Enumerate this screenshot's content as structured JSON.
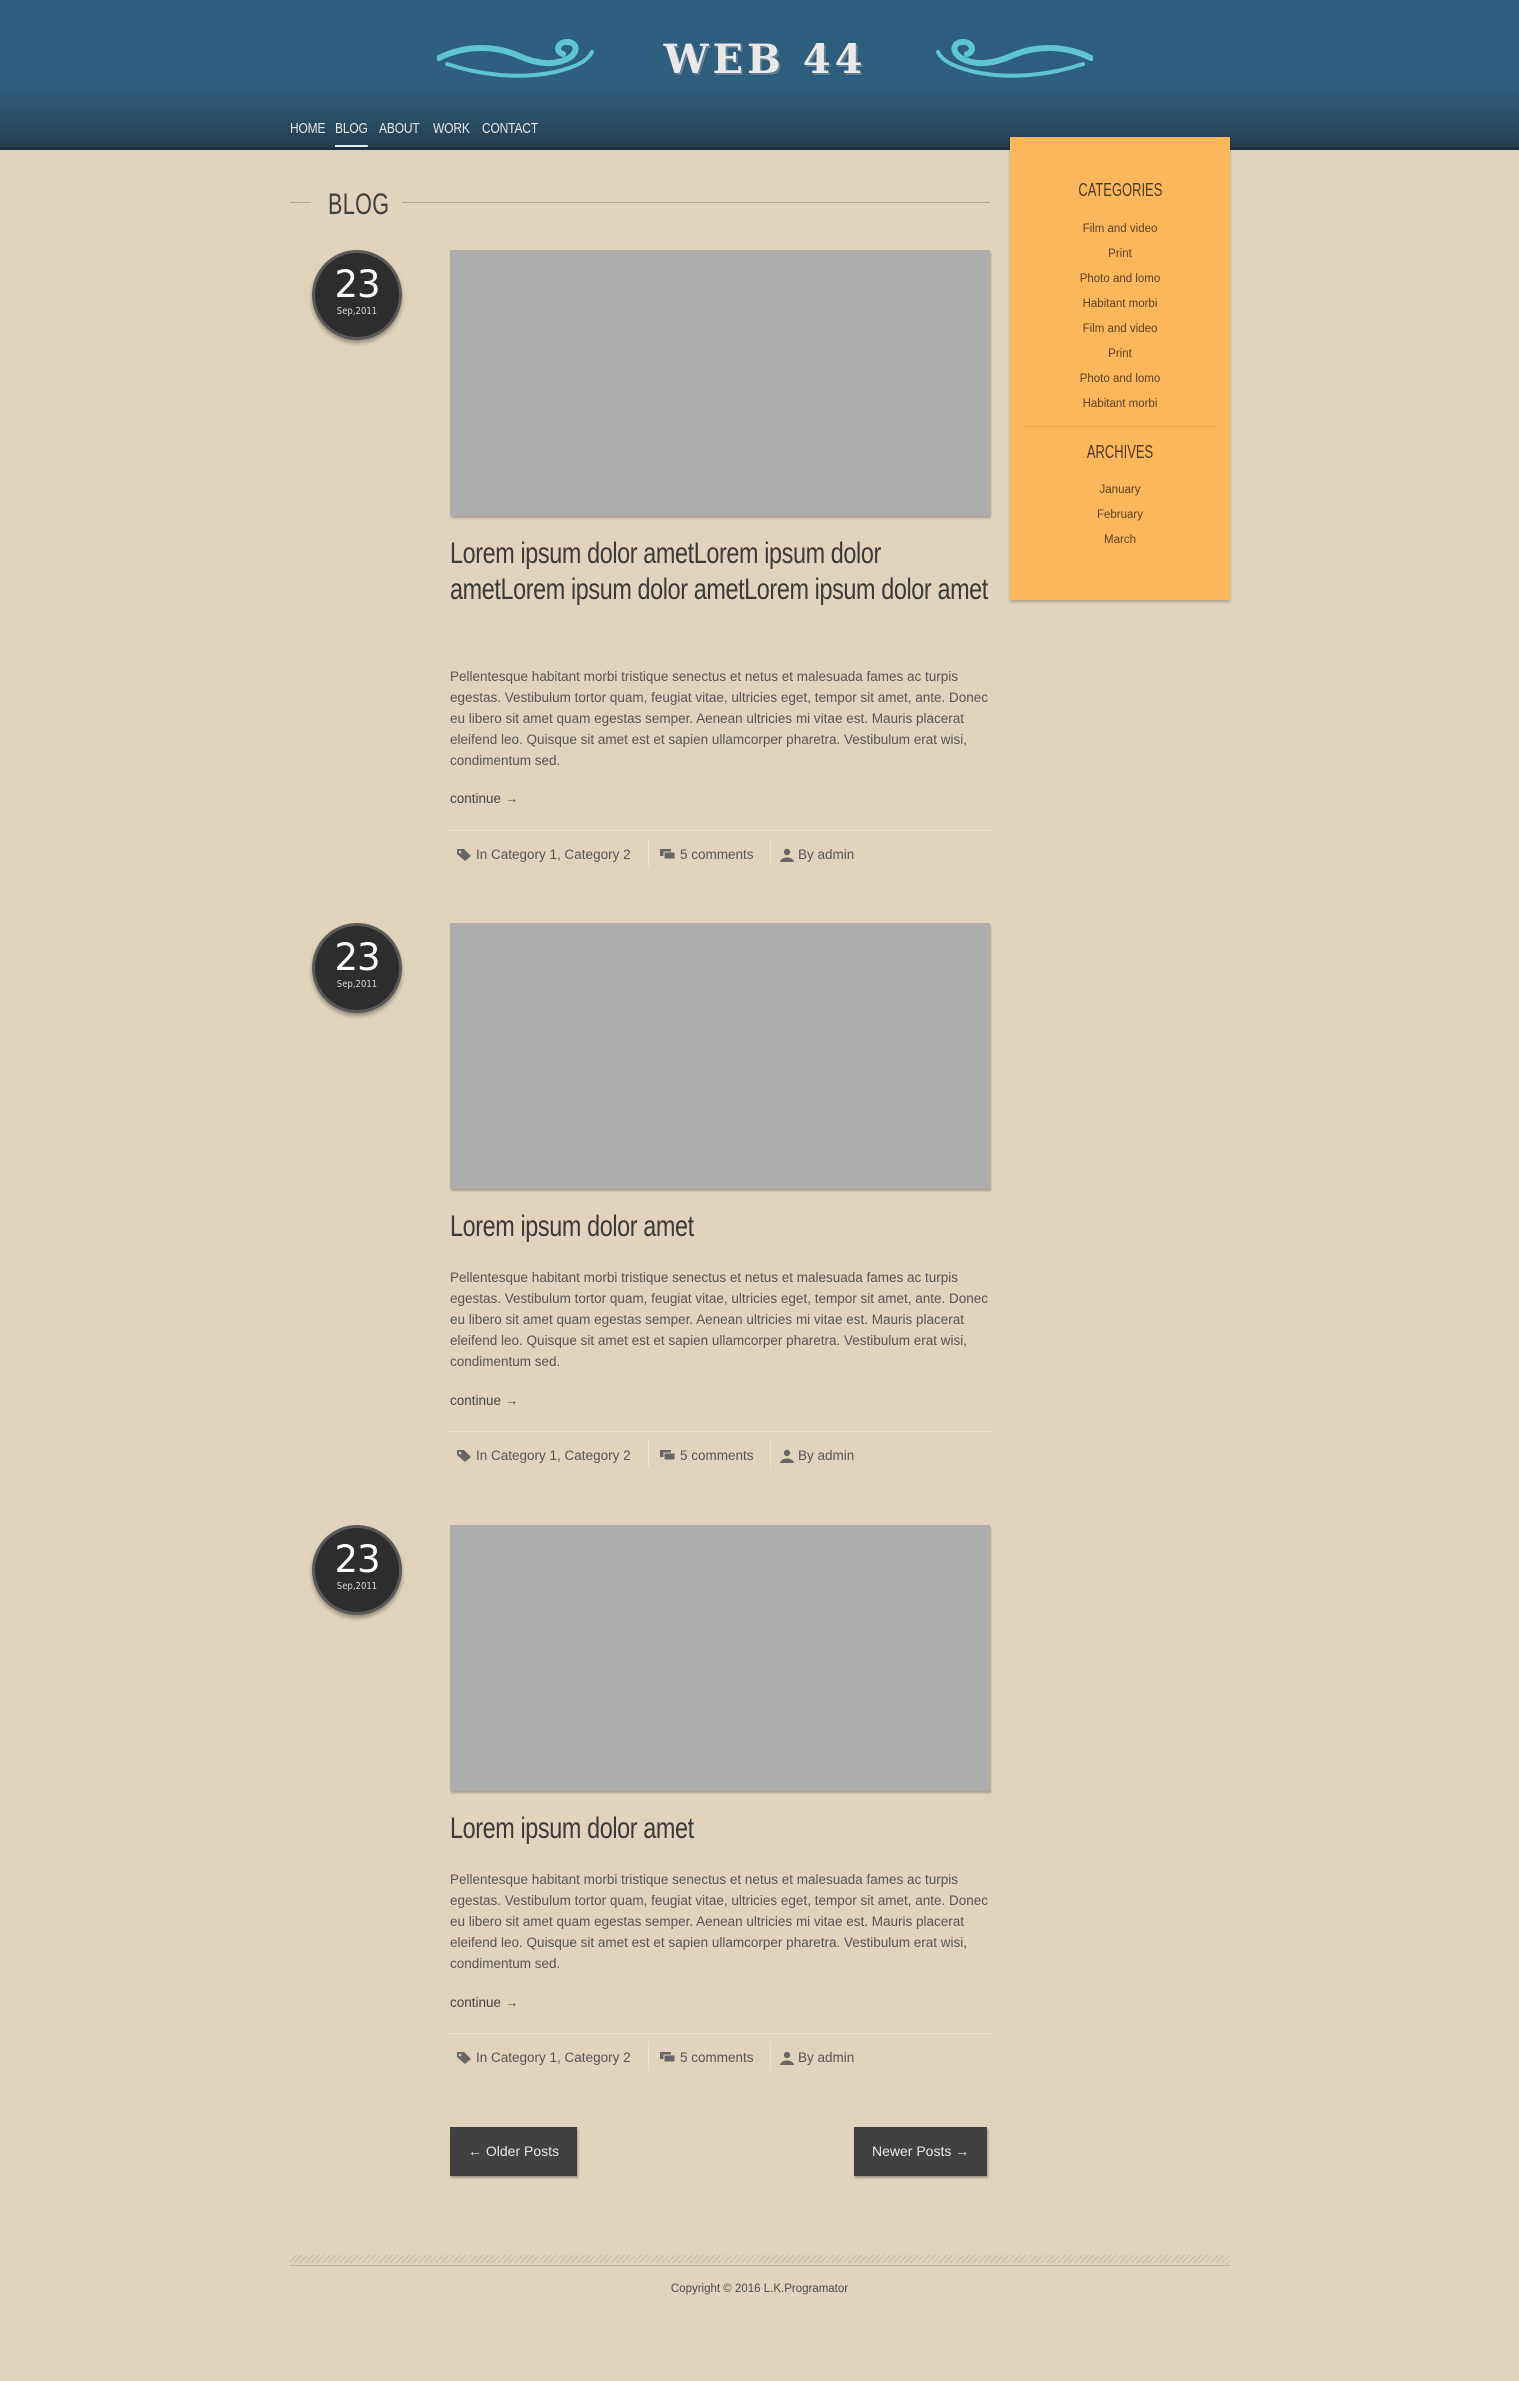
{
  "site": {
    "logo": "WEB 44"
  },
  "nav": {
    "items": [
      {
        "label": "HOME"
      },
      {
        "label": "BLOG"
      },
      {
        "label": "ABOUT"
      },
      {
        "label": "WORK"
      },
      {
        "label": "CONTACT"
      }
    ],
    "active": "BLOG"
  },
  "section": {
    "title": "BLOG"
  },
  "posts": [
    {
      "day": "23",
      "month": "Sep,2011",
      "title": "Lorem ipsum dolor ametLorem ipsum dolor ametLorem ipsum dolor ametLorem ipsum dolor amet",
      "body": "Pellentesque habitant morbi tristique senectus et netus et malesuada fames ac turpis egestas. Vestibulum tortor quam, feugiat vitae, ultricies eget, tempor sit amet, ante. Donec eu libero sit amet quam egestas semper. Aenean ultricies mi vitae est. Mauris placerat eleifend leo. Quisque sit amet est et sapien ullamcorper pharetra. Vestibulum erat wisi, condimentum sed.",
      "continue": "continue →",
      "categories": "In Category 1, Category 2",
      "comments": "5 comments",
      "author": "By admin"
    },
    {
      "day": "23",
      "month": "Sep,2011",
      "title": "Lorem ipsum dolor amet",
      "body": "Pellentesque habitant morbi tristique senectus et netus et malesuada fames ac turpis egestas. Vestibulum tortor quam, feugiat vitae, ultricies eget, tempor sit amet, ante. Donec eu libero sit amet quam egestas semper. Aenean ultricies mi vitae est. Mauris placerat eleifend leo. Quisque sit amet est et sapien ullamcorper pharetra. Vestibulum erat wisi, condimentum sed.",
      "continue": "continue →",
      "categories": "In Category 1, Category 2",
      "comments": "5 comments",
      "author": "By admin"
    },
    {
      "day": "23",
      "month": "Sep,2011",
      "title": "Lorem ipsum dolor amet",
      "body": "Pellentesque habitant morbi tristique senectus et netus et malesuada fames ac turpis egestas. Vestibulum tortor quam, feugiat vitae, ultricies eget, tempor sit amet, ante. Donec eu libero sit amet quam egestas semper. Aenean ultricies mi vitae est. Mauris placerat eleifend leo. Quisque sit amet est et sapien ullamcorper pharetra. Vestibulum erat wisi, condimentum sed.",
      "continue": "continue →",
      "categories": "In Category 1, Category 2",
      "comments": "5 comments",
      "author": "By admin"
    }
  ],
  "pagination": {
    "older": "← Older Posts",
    "newer": "Newer Posts →"
  },
  "sidebar": {
    "categories": {
      "title": "CATEGORIES",
      "items": [
        "Film and video",
        "Print",
        "Photo and lomo",
        "Habitant morbi",
        "Film and video",
        "Print",
        "Photo and lomo",
        "Habitant morbi"
      ]
    },
    "archives": {
      "title": "ARCHIVES",
      "items": [
        "January",
        "February",
        "March"
      ]
    }
  },
  "footer": {
    "copyright": "Copyright © 2016 L.K.Programator"
  },
  "colors": {
    "header": "#2e5e7e",
    "background": "#e2d4bc",
    "sidebar": "#ffb75b",
    "badge": "#2d2d2d",
    "swirl": "#5fc6d0"
  },
  "icons": {
    "categories": "tag-icon",
    "comments": "comment-icon",
    "author": "user-icon",
    "logo_ornament": "swirl-ornament"
  }
}
